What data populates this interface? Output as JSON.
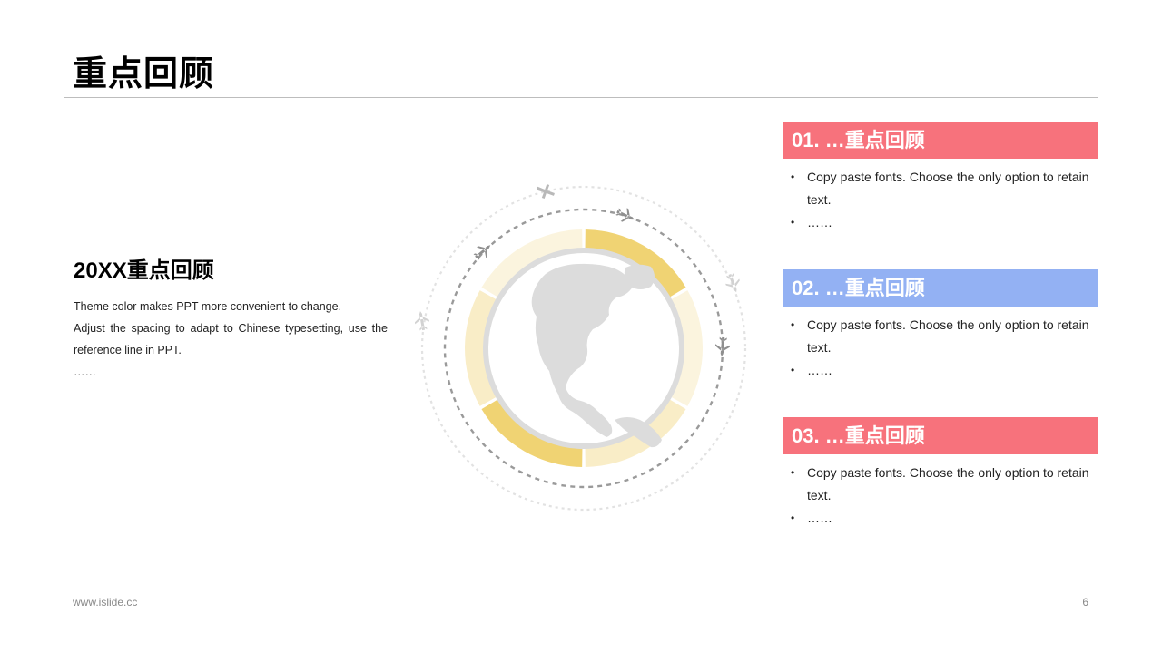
{
  "page": {
    "title": "重点回顾"
  },
  "left": {
    "heading": "20XX重点回顾",
    "lines": [
      "Theme color makes PPT more convenient to change.",
      "Adjust the spacing to adapt to Chinese typesetting, use the reference line in PPT.",
      "……"
    ]
  },
  "cards": [
    {
      "title": "01. …重点回顾",
      "color": "#f7727c",
      "bullets": [
        "Copy paste fonts. Choose the only option to retain text.",
        "……"
      ]
    },
    {
      "title": "02. …重点回顾",
      "color": "#93b1f3",
      "bullets": [
        "Copy paste fonts. Choose the only option to retain text.",
        "……"
      ]
    },
    {
      "title": "03. …重点回顾",
      "color": "#f7727c",
      "bullets": [
        "Copy paste fonts. Choose the only option to retain text.",
        "……"
      ]
    }
  ],
  "graphic": {
    "ring_colors": [
      "#f0d373",
      "#f9edc7",
      "#fbf4de",
      "#f5e3a7"
    ],
    "globe_color": "#dcdcdc",
    "icons": [
      "globe-icon",
      "airplane-icon"
    ]
  },
  "footer": {
    "url": "www.islide.cc",
    "page_number": "6"
  }
}
